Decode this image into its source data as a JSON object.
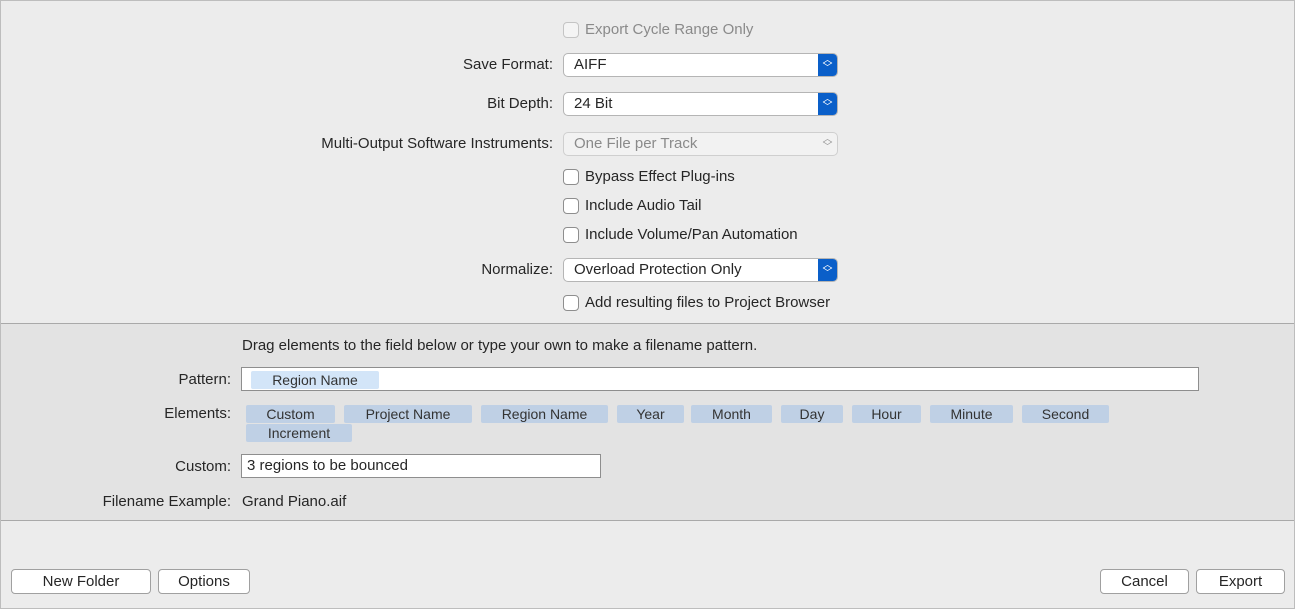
{
  "options": {
    "export_cycle_range_only": {
      "label": "Export Cycle Range Only",
      "checked": false,
      "disabled": true
    },
    "save_format": {
      "label": "Save Format:",
      "value": "AIFF"
    },
    "bit_depth": {
      "label": "Bit Depth:",
      "value": "24 Bit"
    },
    "multi_output": {
      "label": "Multi-Output Software Instruments:",
      "value": "One File per Track",
      "disabled": true
    },
    "bypass_effects": {
      "label": "Bypass Effect Plug-ins",
      "checked": false
    },
    "include_audio_tail": {
      "label": "Include Audio Tail",
      "checked": false
    },
    "include_automation": {
      "label": "Include Volume/Pan Automation",
      "checked": false
    },
    "normalize": {
      "label": "Normalize:",
      "value": "Overload Protection Only"
    },
    "add_to_browser": {
      "label": "Add resulting files to Project Browser",
      "checked": false
    }
  },
  "filename": {
    "instructions": "Drag elements to the field below or type your own to make a filename pattern.",
    "pattern_label": "Pattern:",
    "pattern_tokens": [
      "Region Name"
    ],
    "elements_label": "Elements:",
    "elements": [
      "Custom",
      "Project Name",
      "Region Name",
      "Year",
      "Month",
      "Day",
      "Hour",
      "Minute",
      "Second",
      "Increment"
    ],
    "custom_label": "Custom:",
    "custom_value": "3 regions to be bounced",
    "example_label": "Filename Example:",
    "example_value": "Grand Piano.aif"
  },
  "buttons": {
    "new_folder": "New Folder",
    "options": "Options",
    "cancel": "Cancel",
    "export": "Export"
  },
  "colors": {
    "accent": "#0a5fc9",
    "token": "#bfd0e5",
    "pattern_token": "#d3e5f8"
  }
}
